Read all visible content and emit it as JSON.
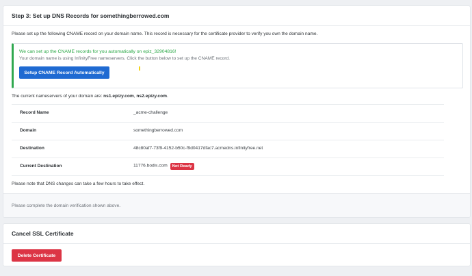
{
  "step3": {
    "title": "Step 3: Set up DNS Records for somethingberrowed.com",
    "intro": "Please set up the following CNAME record on your domain name. This record is necessary for the certificate provider to verify you own the domain name.",
    "callout": {
      "headline": "We can set up the CNAME records for you automatically on epiz_32904816!",
      "subline": "Your domain name is using InfinityFree nameservers. Click the button below to set up the CNAME record.",
      "button_label": "Setup CNAME Record Automatically"
    },
    "nameservers": {
      "prefix": "The current nameservers of your domain are: ",
      "ns1": "ns1.epizy.com",
      "separator": ", ",
      "ns2": "ns2.epizy.com",
      "suffix": "."
    },
    "records": [
      {
        "label": "Record Name",
        "value": "_acme-challenge"
      },
      {
        "label": "Domain",
        "value": "somethingberrowed.com"
      },
      {
        "label": "Destination",
        "value": "48c80af7-73f9-4152-b50c-f9d0417dfac7.acmedns.infinityfree.net"
      },
      {
        "label": "Current Destination",
        "value": "11776.bodis.com",
        "badge": "Not Ready"
      }
    ],
    "note": "Please note that DNS changes can take a few hours to take effect.",
    "footer": "Please complete the domain verification shown above."
  },
  "cancel": {
    "title": "Cancel SSL Certificate",
    "button_label": "Delete Certificate"
  },
  "colors": {
    "primary": "#1f6ad2",
    "success": "#28a745",
    "danger": "#dc3545",
    "background": "#eef0f3"
  }
}
